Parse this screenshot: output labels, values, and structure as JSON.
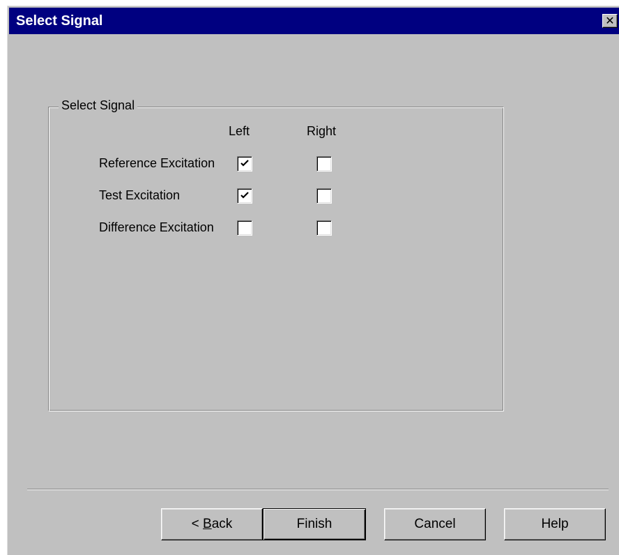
{
  "window": {
    "title": "Select Signal",
    "close_glyph": "✕"
  },
  "group": {
    "title": "Select Signal",
    "columns": {
      "left": "Left",
      "right": "Right"
    },
    "rows": [
      {
        "label": "Reference Excitation",
        "left_checked": true,
        "right_checked": false
      },
      {
        "label": "Test Excitation",
        "left_checked": true,
        "right_checked": false
      },
      {
        "label": "Difference Excitation",
        "left_checked": false,
        "right_checked": false
      }
    ]
  },
  "buttons": {
    "back_prefix": "< ",
    "back_accel": "B",
    "back_rest": "ack",
    "finish": "Finish",
    "cancel": "Cancel",
    "help": "Help"
  },
  "icons": {
    "check": "check-icon",
    "close": "close-icon"
  }
}
